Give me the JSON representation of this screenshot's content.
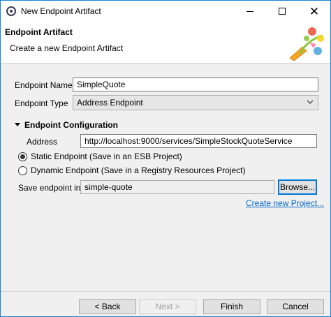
{
  "window": {
    "title": "New Endpoint Artifact"
  },
  "banner": {
    "title": "Endpoint Artifact",
    "subtitle": "Create a new Endpoint Artifact"
  },
  "form": {
    "endpoint_name_label": "Endpoint Name",
    "endpoint_name_value": "SimpleQuote",
    "endpoint_type_label": "Endpoint Type",
    "endpoint_type_value": "Address Endpoint",
    "section_title": "Endpoint Configuration",
    "address_label": "Address",
    "address_value": "http://localhost:9000/services/SimpleStockQuoteService",
    "radio_static_label": "Static Endpoint (Save in an ESB Project)",
    "radio_dynamic_label": "Dynamic Endpoint (Save in a Registry Resources Project)",
    "selected_radio": "static",
    "save_in_label": "Save endpoint in:",
    "save_in_value": "simple-quote",
    "browse_label": "Browse...",
    "create_project_link": "Create new Project..."
  },
  "footer": {
    "back_label": "< Back",
    "next_label": "Next >",
    "finish_label": "Finish",
    "cancel_label": "Cancel"
  },
  "colors": {
    "accent": "#0078d7",
    "link": "#0066cc",
    "dialog_bg": "#f0f0f0"
  }
}
